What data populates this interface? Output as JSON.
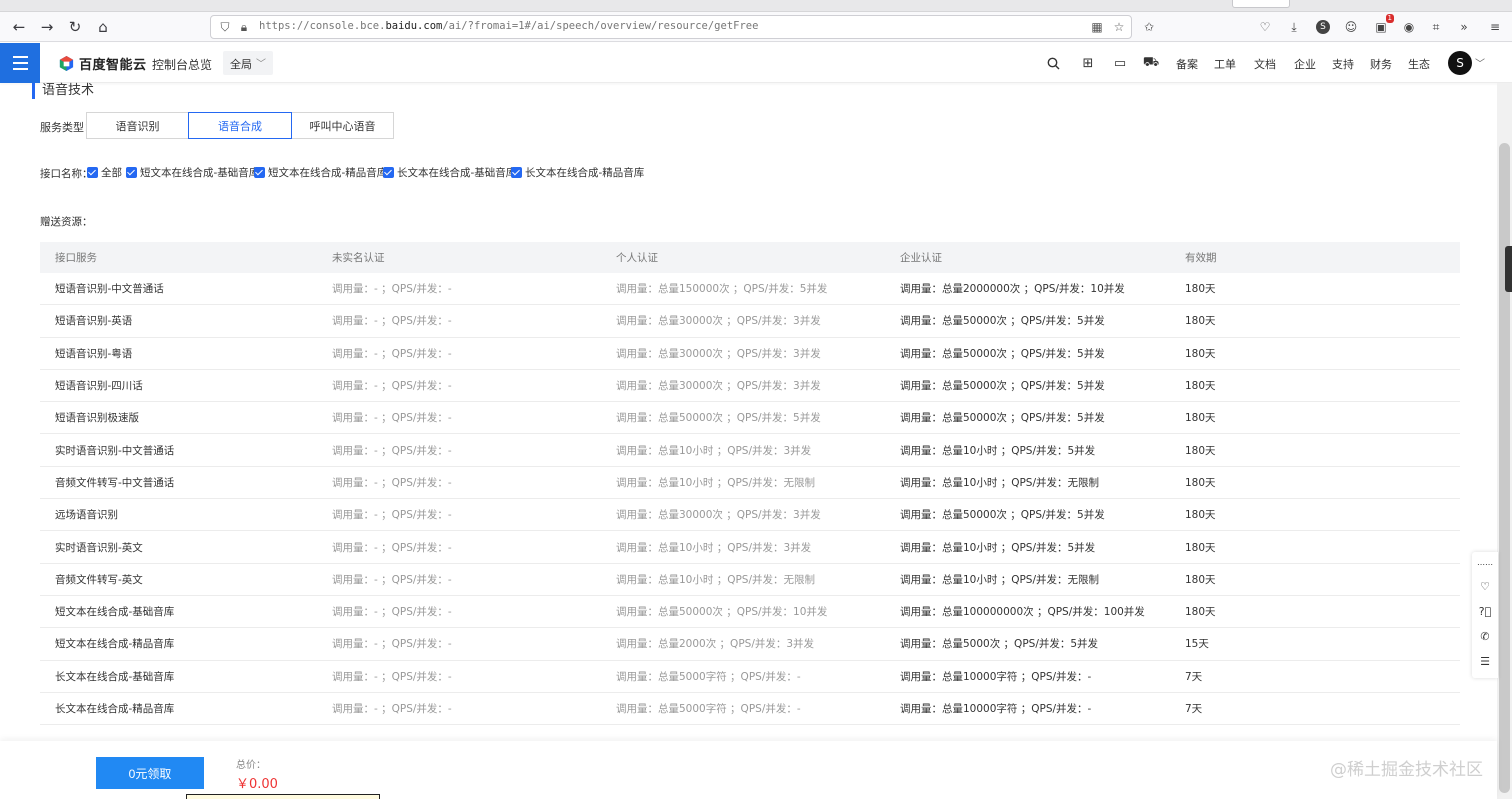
{
  "browser": {
    "url_prefix": "https://console.bce.",
    "url_domain": "baidu.com",
    "url_suffix": "/ai/?fromai=1#/ai/speech/overview/resource/getFree",
    "ext_badge": "1",
    "ext_s": "S"
  },
  "header": {
    "logo_text": "百度智能云",
    "console_link": "控制台总览",
    "region": "全局",
    "links": [
      "备案",
      "工单",
      "文档",
      "企业",
      "支持",
      "财务",
      "生态"
    ],
    "avatar_letter": "S"
  },
  "section": {
    "title": "语音技术",
    "service_type_label": "服务类型：",
    "service_tabs": [
      "语音识别",
      "语音合成",
      "呼叫中心语音"
    ],
    "interface_label": "接口名称：",
    "interface_options": [
      "全部",
      "短文本在线合成-基础音库",
      "短文本在线合成-精品音库",
      "长文本在线合成-基础音库",
      "长文本在线合成-精品音库"
    ],
    "gift_label": "赠送资源："
  },
  "table": {
    "headers": [
      "接口服务",
      "未实名认证",
      "个人认证",
      "企业认证",
      "有效期"
    ],
    "rows": [
      [
        "短语音识别-中文普通话",
        "调用量：- ；QPS/并发：-",
        "调用量：总量150000次 ；QPS/并发：5并发",
        "调用量：总量2000000次 ；QPS/并发：10并发",
        "180天"
      ],
      [
        "短语音识别-英语",
        "调用量：- ；QPS/并发：-",
        "调用量：总量30000次 ；QPS/并发：3并发",
        "调用量：总量50000次 ；QPS/并发：5并发",
        "180天"
      ],
      [
        "短语音识别-粤语",
        "调用量：- ；QPS/并发：-",
        "调用量：总量30000次 ；QPS/并发：3并发",
        "调用量：总量50000次 ；QPS/并发：5并发",
        "180天"
      ],
      [
        "短语音识别-四川话",
        "调用量：- ；QPS/并发：-",
        "调用量：总量30000次 ；QPS/并发：3并发",
        "调用量：总量50000次 ；QPS/并发：5并发",
        "180天"
      ],
      [
        "短语音识别极速版",
        "调用量：- ；QPS/并发：-",
        "调用量：总量50000次 ；QPS/并发：5并发",
        "调用量：总量50000次 ；QPS/并发：5并发",
        "180天"
      ],
      [
        "实时语音识别-中文普通话",
        "调用量：- ；QPS/并发：-",
        "调用量：总量10小时 ；QPS/并发：3并发",
        "调用量：总量10小时 ；QPS/并发：5并发",
        "180天"
      ],
      [
        "音频文件转写-中文普通话",
        "调用量：- ；QPS/并发：-",
        "调用量：总量10小时 ；QPS/并发：无限制",
        "调用量：总量10小时 ；QPS/并发：无限制",
        "180天"
      ],
      [
        "远场语音识别",
        "调用量：- ；QPS/并发：-",
        "调用量：总量30000次 ；QPS/并发：3并发",
        "调用量：总量50000次 ；QPS/并发：5并发",
        "180天"
      ],
      [
        "实时语音识别-英文",
        "调用量：- ；QPS/并发：-",
        "调用量：总量10小时 ；QPS/并发：3并发",
        "调用量：总量10小时 ；QPS/并发：5并发",
        "180天"
      ],
      [
        "音频文件转写-英文",
        "调用量：- ；QPS/并发：-",
        "调用量：总量10小时 ；QPS/并发：无限制",
        "调用量：总量10小时 ；QPS/并发：无限制",
        "180天"
      ],
      [
        "短文本在线合成-基础音库",
        "调用量：- ；QPS/并发：-",
        "调用量：总量50000次 ；QPS/并发：10并发",
        "调用量：总量100000000次 ；QPS/并发：100并发",
        "180天"
      ],
      [
        "短文本在线合成-精品音库",
        "调用量：- ；QPS/并发：-",
        "调用量：总量2000次 ；QPS/并发：3并发",
        "调用量：总量5000次 ；QPS/并发：5并发",
        "15天"
      ],
      [
        "长文本在线合成-基础音库",
        "调用量：- ；QPS/并发：-",
        "调用量：总量5000字符 ；QPS/并发：-",
        "调用量：总量10000字符 ；QPS/并发：-",
        "7天"
      ],
      [
        "长文本在线合成-精品音库",
        "调用量：- ；QPS/并发：-",
        "调用量：总量5000字符 ；QPS/并发：-",
        "调用量：总量10000字符 ；QPS/并发：-",
        "7天"
      ]
    ]
  },
  "footer": {
    "claim_button": "0元领取",
    "total_label": "总价：",
    "total_value": "￥0.00",
    "watermark": "@稀土掘金技术社区"
  },
  "colors": {
    "accent": "#2468f2",
    "claim_button": "#2189f3",
    "price": "#e33333"
  }
}
